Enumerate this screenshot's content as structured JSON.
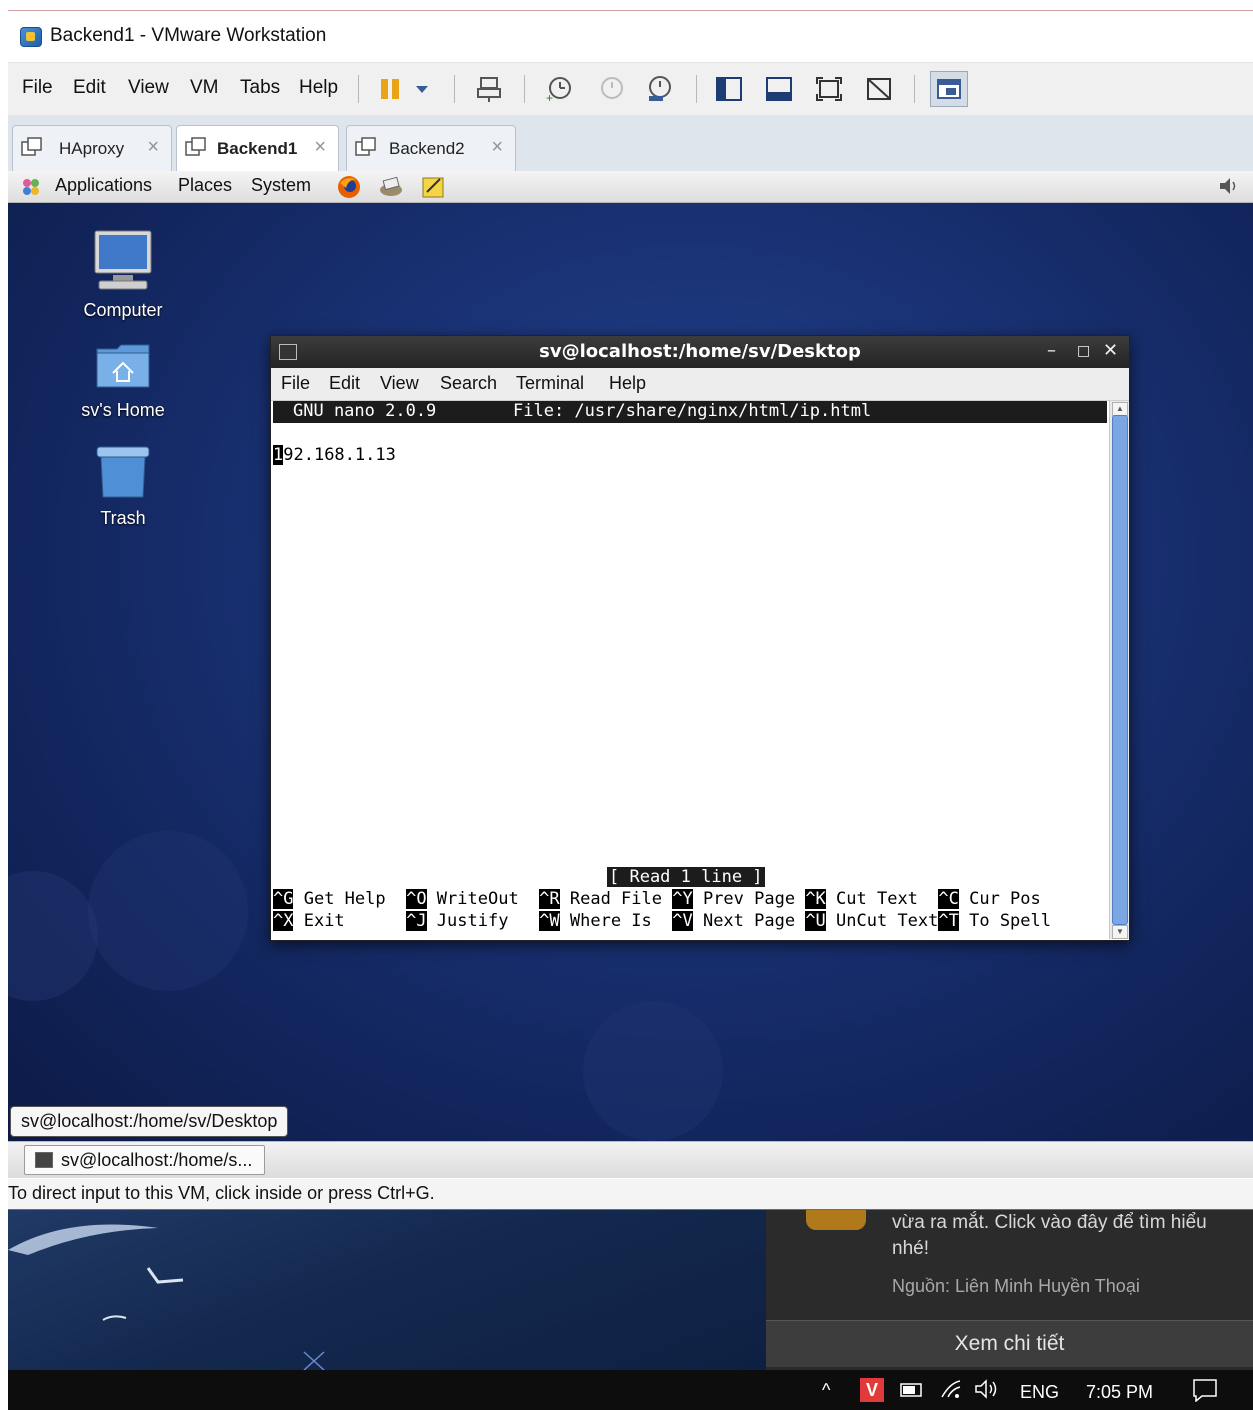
{
  "window": {
    "title": "Backend1 - VMware Workstation"
  },
  "menubar": {
    "items": [
      "File",
      "Edit",
      "View",
      "VM",
      "Tabs",
      "Help"
    ]
  },
  "tabs": [
    {
      "label": "HAproxy",
      "active": false
    },
    {
      "label": "Backend1",
      "active": true
    },
    {
      "label": "Backend2",
      "active": false
    }
  ],
  "gnome_panel": {
    "items": [
      "Applications",
      "Places",
      "System"
    ]
  },
  "desktop_icons": [
    "Computer",
    "sv's Home",
    "Trash"
  ],
  "terminal": {
    "title": "sv@localhost:/home/sv/Desktop",
    "menu": [
      "File",
      "Edit",
      "View",
      "Search",
      "Terminal",
      "Help"
    ],
    "nano_version": "GNU nano 2.0.9",
    "nano_file": "File: /usr/share/nginx/html/ip.html",
    "content_first_char": "1",
    "content_rest": "92.168.1.13",
    "status": "[ Read 1 line ]",
    "shortcuts_row1": [
      {
        "key": "^G",
        "label": " Get Help  "
      },
      {
        "key": "^O",
        "label": " WriteOut  "
      },
      {
        "key": "^R",
        "label": " Read File "
      },
      {
        "key": "^Y",
        "label": " Prev Page "
      },
      {
        "key": "^K",
        "label": " Cut Text  "
      },
      {
        "key": "^C",
        "label": " Cur Pos"
      }
    ],
    "shortcuts_row2": [
      {
        "key": "^X",
        "label": " Exit      "
      },
      {
        "key": "^J",
        "label": " Justify   "
      },
      {
        "key": "^W",
        "label": " Where Is  "
      },
      {
        "key": "^V",
        "label": " Next Page "
      },
      {
        "key": "^U",
        "label": " UnCut Text"
      },
      {
        "key": "^T",
        "label": " To Spell"
      }
    ]
  },
  "tooltip": "sv@localhost:/home/sv/Desktop",
  "taskbar_button": "sv@localhost:/home/s...",
  "vm_status": "To direct input to this VM, click inside or press Ctrl+G.",
  "notification": {
    "message": "vừa ra mắt. Click vào đây để tìm hiểu nhé!",
    "source": "Nguồn: Liên Minh Huyền Thoại",
    "button": "Xem chi tiết"
  },
  "tray": {
    "language": "ENG",
    "time": "7:05 PM"
  },
  "colors": {
    "guest_bg": "#1b3478",
    "terminal_titlebar": "#2e2e2e",
    "status_accent": "#cc4444"
  }
}
